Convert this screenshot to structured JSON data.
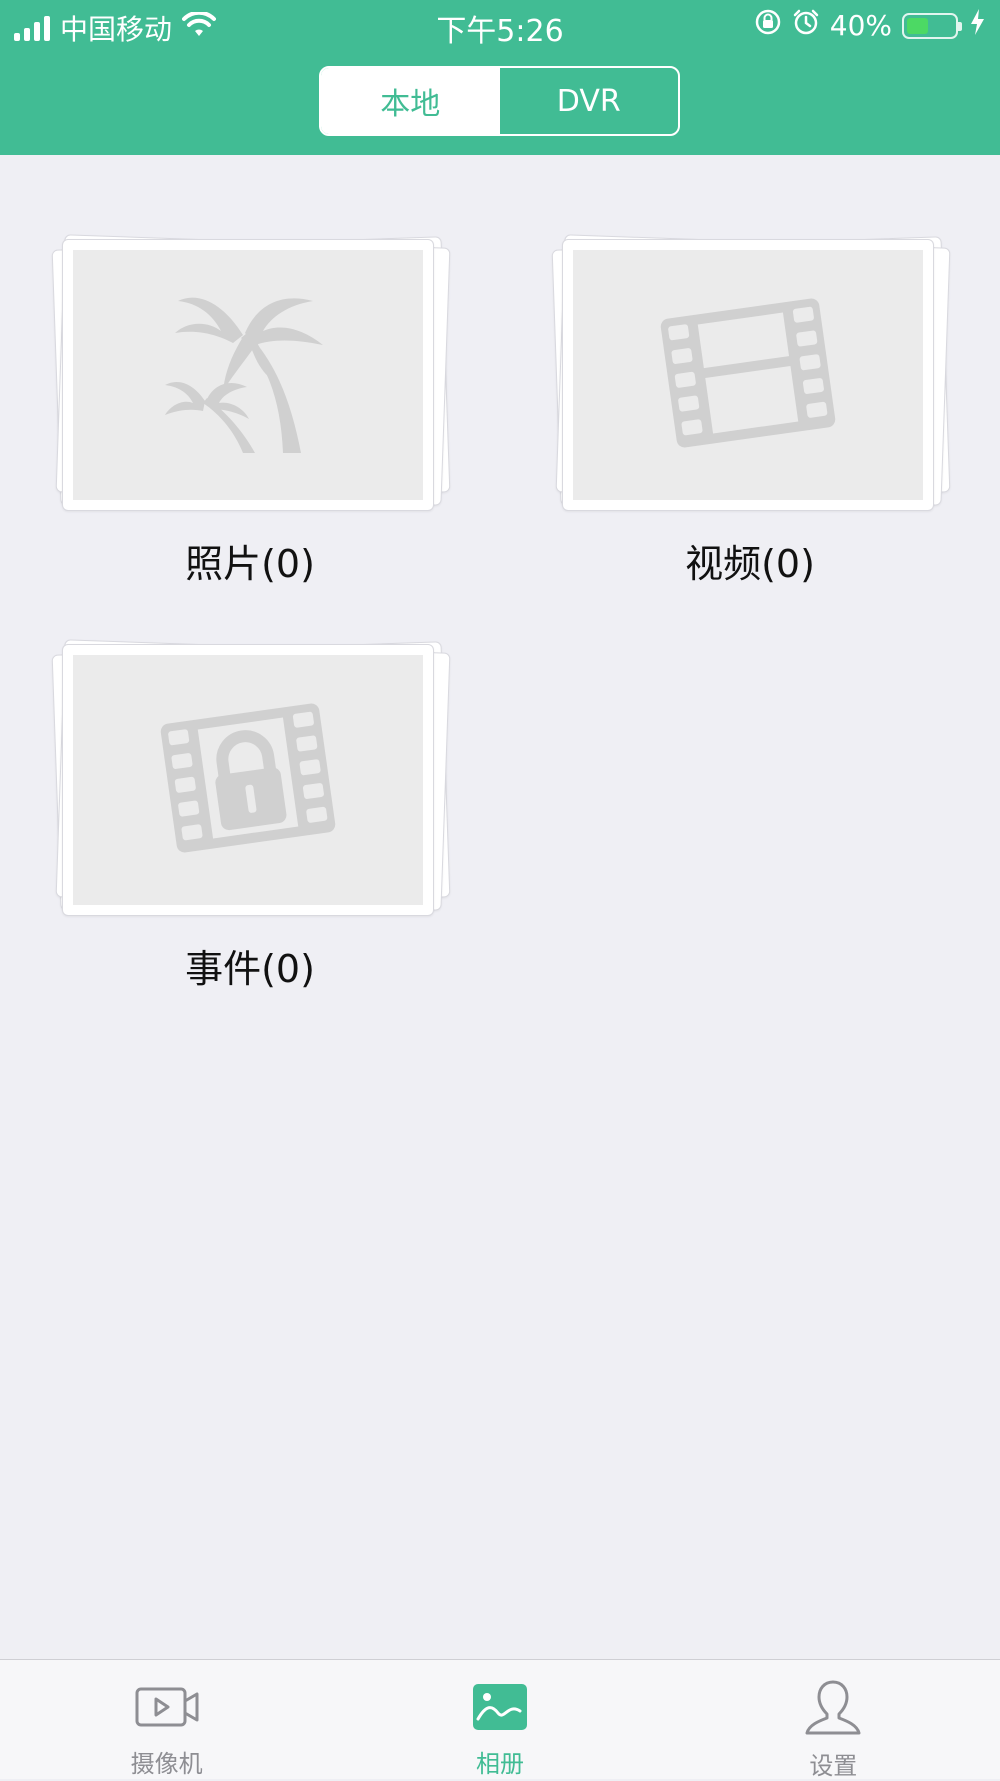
{
  "status_bar": {
    "carrier": "中国移动",
    "time": "下午5:26",
    "battery_percent": "40%",
    "battery_level": 0.4
  },
  "segment": {
    "options": [
      "本地",
      "DVR"
    ],
    "selected": "本地"
  },
  "albums": [
    {
      "label": "照片(0)",
      "icon": "palm-tree-icon"
    },
    {
      "label": "视频(0)",
      "icon": "film-strip-icon"
    },
    {
      "label": "事件(0)",
      "icon": "locked-film-icon"
    }
  ],
  "tabbar": {
    "items": [
      {
        "label": "摄像机",
        "icon": "video-camera-icon"
      },
      {
        "label": "相册",
        "icon": "album-icon"
      },
      {
        "label": "设置",
        "icon": "user-icon"
      }
    ],
    "active": "相册"
  },
  "colors": {
    "accent": "#41bc94",
    "background": "#efeff4",
    "placeholder": "#ebebeb",
    "icon_gray": "#d0d0d0"
  }
}
